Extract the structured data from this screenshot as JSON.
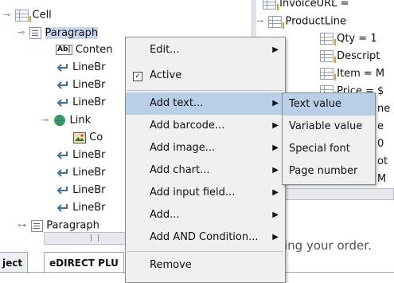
{
  "tree": {
    "rows": [
      {
        "label": "Cell",
        "indent": 0,
        "icon": "table-icon",
        "expanded": true
      },
      {
        "label": "Paragraph",
        "indent": 1,
        "icon": "paragraph-icon",
        "expanded": true,
        "selected": true
      },
      {
        "label": "Conten",
        "indent": 2,
        "icon": "text-ab-icon"
      },
      {
        "label": "LineBr",
        "indent": 2,
        "icon": "linebreak-icon"
      },
      {
        "label": "LineBr",
        "indent": 2,
        "icon": "linebreak-icon"
      },
      {
        "label": "LineBr",
        "indent": 2,
        "icon": "linebreak-icon"
      },
      {
        "label": "Link",
        "indent": 2,
        "icon": "globe-link-icon",
        "expanded": true
      },
      {
        "label": "Co",
        "indent": 3,
        "icon": "image-icon"
      },
      {
        "label": "LineBr",
        "indent": 2,
        "icon": "linebreak-icon"
      },
      {
        "label": "LineBr",
        "indent": 2,
        "icon": "linebreak-icon"
      },
      {
        "label": "LineBr",
        "indent": 2,
        "icon": "linebreak-icon"
      },
      {
        "label": "LineBr",
        "indent": 2,
        "icon": "linebreak-icon"
      },
      {
        "label": "Paragraph",
        "indent": 1,
        "icon": "paragraph-icon",
        "expanded": false
      }
    ]
  },
  "right_tree": {
    "rows": [
      {
        "label": "InvoiceURL ="
      },
      {
        "label": "ProductLine"
      },
      {
        "label": "Qty = 1"
      },
      {
        "label": "Descript"
      },
      {
        "label": "Item = M"
      },
      {
        "label": "Price = $"
      },
      {
        "label": "ne"
      },
      {
        "label": "e"
      },
      {
        "label": "0"
      },
      {
        "label": "ot"
      },
      {
        "label": "M"
      }
    ]
  },
  "tabs": [
    {
      "label": "ject"
    },
    {
      "label": "eDIRECT PLU"
    }
  ],
  "background_text": "ing your order.",
  "context_menu": {
    "items": [
      {
        "label": "Edit...",
        "submenu": true
      },
      {
        "label": "Active",
        "checkbox": true,
        "checked": true
      },
      {
        "label": "Add text...",
        "submenu": true,
        "highlighted": true
      },
      {
        "label": "Add barcode...",
        "submenu": true
      },
      {
        "label": "Add image...",
        "submenu": true
      },
      {
        "label": "Add chart...",
        "submenu": true
      },
      {
        "label": "Add input field...",
        "submenu": true
      },
      {
        "label": "Add...",
        "submenu": true
      },
      {
        "label": "Add AND Condition...",
        "submenu": true
      },
      {
        "label": "Remove",
        "submenu": false
      }
    ],
    "check_glyph": "✓",
    "arrow_glyph": "▶"
  },
  "submenu": {
    "items": [
      {
        "label": "Text value",
        "highlighted": true
      },
      {
        "label": "Variable value"
      },
      {
        "label": "Special font"
      },
      {
        "label": "Page number"
      }
    ]
  },
  "colors": {
    "highlight": "#b9cfe8",
    "selection": "#c7d7ef",
    "menu_bg": "#f0f0f0"
  }
}
